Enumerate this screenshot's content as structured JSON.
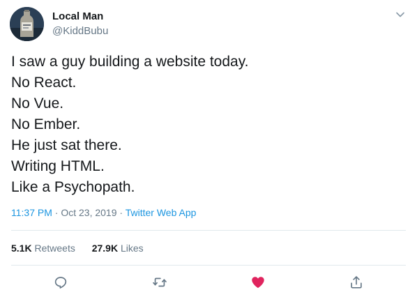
{
  "author": {
    "display_name": "Local Man",
    "handle": "@KiddBubu"
  },
  "tweet": {
    "lines": [
      "I saw a guy building a website today.",
      "No React.",
      "No Vue.",
      "No Ember.",
      "He just sat there.",
      "Writing HTML.",
      "Like a Psychopath."
    ],
    "time": "11:37 PM",
    "date": "Oct 23, 2019",
    "separator": "·",
    "source": "Twitter Web App"
  },
  "stats": {
    "retweets_count": "5.1K",
    "retweets_label": "Retweets",
    "likes_count": "27.9K",
    "likes_label": "Likes"
  },
  "actions": {
    "reply_icon": "reply-icon",
    "retweet_icon": "retweet-icon",
    "like_icon": "heart-icon",
    "share_icon": "share-icon"
  },
  "colors": {
    "text": "#14171a",
    "secondary": "#657786",
    "link": "#1b95e0",
    "like_active": "#e0245e",
    "divider": "#e1e8ed"
  }
}
